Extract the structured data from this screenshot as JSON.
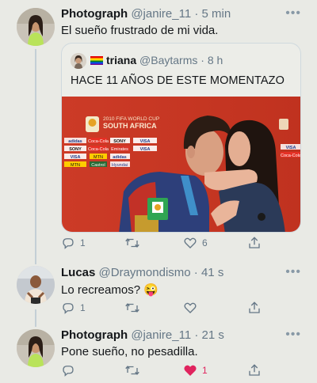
{
  "tweets": [
    {
      "name": "Photograph",
      "handle": "@janire_11",
      "time": "5 min",
      "text": "El sueño frustrado de mi vida.",
      "quote": {
        "name": "triana",
        "handle": "@Baytarms",
        "time": "8 h",
        "text": "HACE 11 AÑOS DE ESTE MOMENTAZO",
        "media_text": {
          "event_line1": "2010 FIFA WORLD CUP",
          "event_line2": "SOUTH AFRICA",
          "sponsors": [
            "adidas",
            "SONY",
            "Coca-Cola",
            "Emirates",
            "VISA",
            "MTN",
            "Castrol",
            "Hyundai"
          ]
        }
      },
      "actions": {
        "reply_count": "1",
        "retweet_count": "",
        "like_count": "6"
      }
    },
    {
      "name": "Lucas",
      "handle": "@Draymondismo",
      "time": "41 s",
      "text": "Lo recreamos?",
      "emoji": "😜",
      "actions": {
        "reply_count": "1",
        "retweet_count": "",
        "like_count": ""
      }
    },
    {
      "name": "Photograph",
      "handle": "@janire_11",
      "time": "21 s",
      "text": "Pone sueño, no pesadilla.",
      "actions": {
        "reply_count": "",
        "retweet_count": "",
        "like_count": "1"
      }
    }
  ],
  "ui": {
    "separator": "·",
    "more": "•••"
  },
  "icons": [
    "reply-icon",
    "retweet-icon",
    "like-icon",
    "share-icon",
    "more-icon"
  ],
  "colors": {
    "background": "#e9eae5",
    "text": "#14171a",
    "secondary": "#657786",
    "like_active": "#e0245e",
    "thread_line": "#c4cfd6"
  }
}
